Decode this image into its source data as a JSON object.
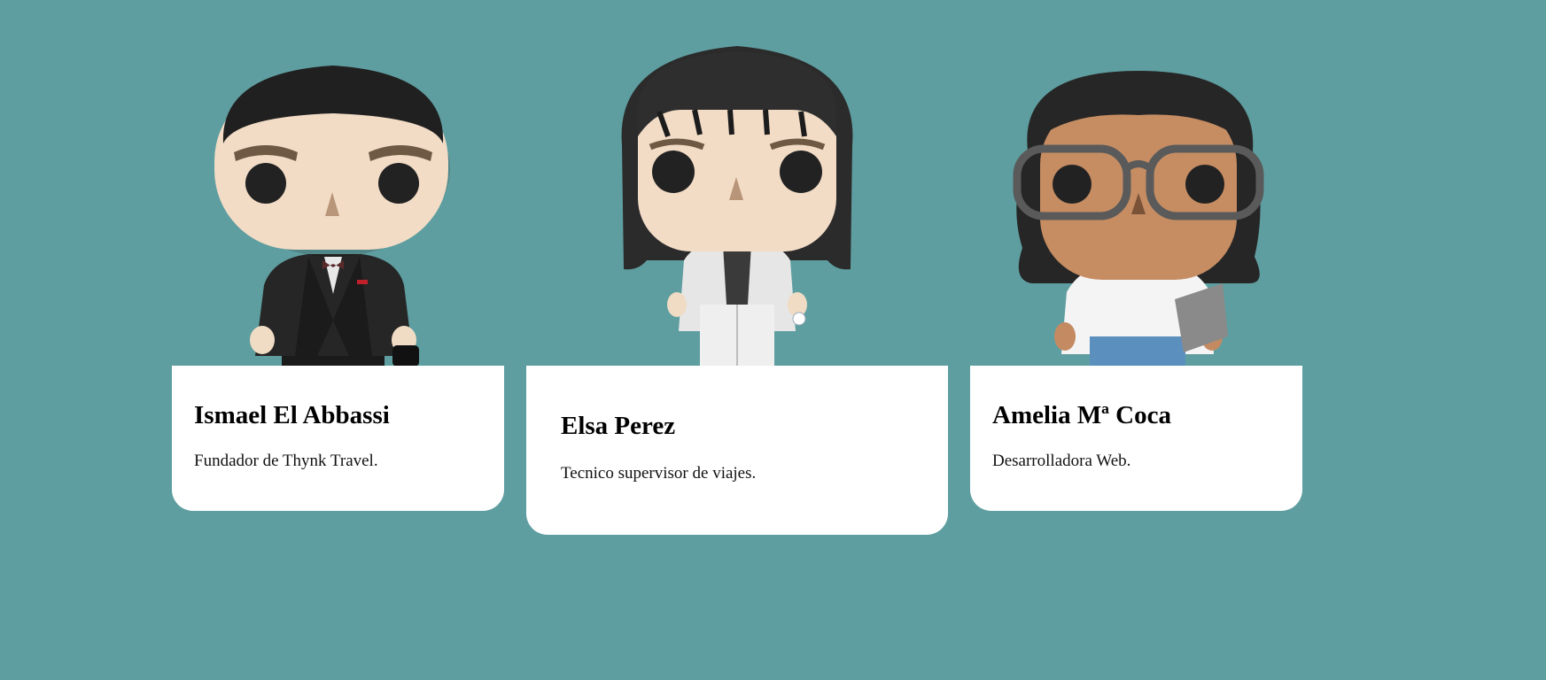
{
  "team": [
    {
      "name": "Ismael El Abbassi",
      "role": "Fundador de Thynk Travel."
    },
    {
      "name": "Elsa Perez",
      "role": "Tecnico supervisor de viajes."
    },
    {
      "name": "Amelia Mª Coca",
      "role": "Desarrolladora Web."
    }
  ],
  "colors": {
    "background": "#5f9ea0",
    "card": "#ffffff"
  }
}
